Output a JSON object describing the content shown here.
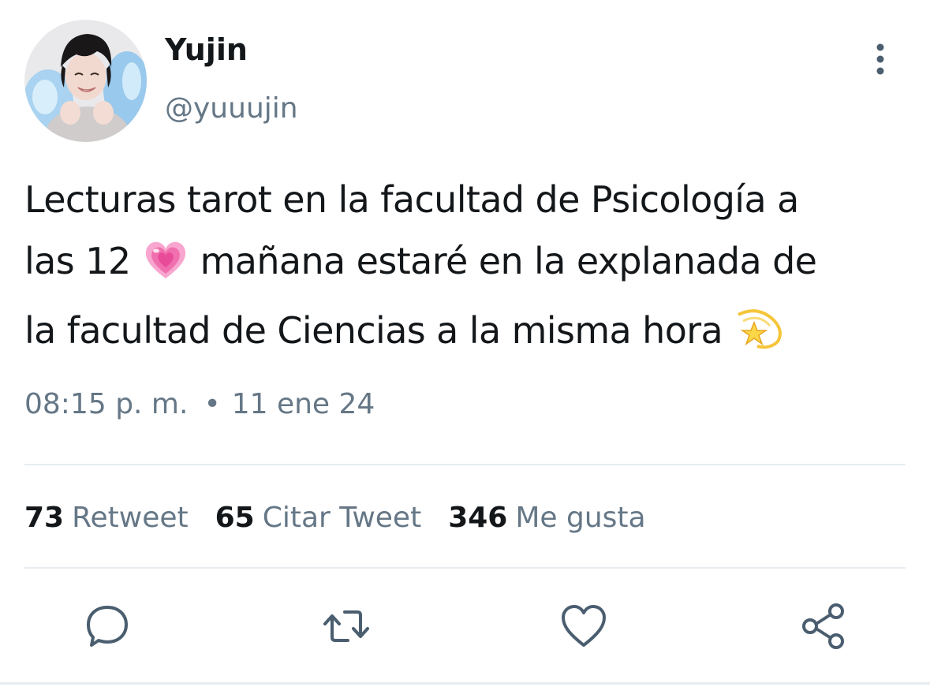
{
  "author": {
    "display_name": "Yujin",
    "handle": "@yuuujin"
  },
  "tweet": {
    "line1": "Lecturas tarot en la facultad de Psicología a",
    "line2_before": "las 12",
    "line2_after": "mañana estaré en la explanada de",
    "line3": "la facultad de Ciencias a la misma hora",
    "emoji_1": "growing-heart",
    "emoji_2": "dizzy-star"
  },
  "meta": {
    "time": "08:15 p. m.",
    "separator": "•",
    "date": "11 ene 24"
  },
  "stats": {
    "retweets_count": "73",
    "retweets_label": "Retweet",
    "quotes_count": "65",
    "quotes_label": "Citar Tweet",
    "likes_count": "346",
    "likes_label": "Me gusta"
  },
  "actions": {
    "reply_icon": "reply-icon",
    "retweet_icon": "retweet-icon",
    "like_icon": "heart-icon",
    "share_icon": "share-icon"
  },
  "colors": {
    "text": "#14171a",
    "secondary": "#657786",
    "divider": "#e6ecf0",
    "icon": "#4a5e6f"
  }
}
